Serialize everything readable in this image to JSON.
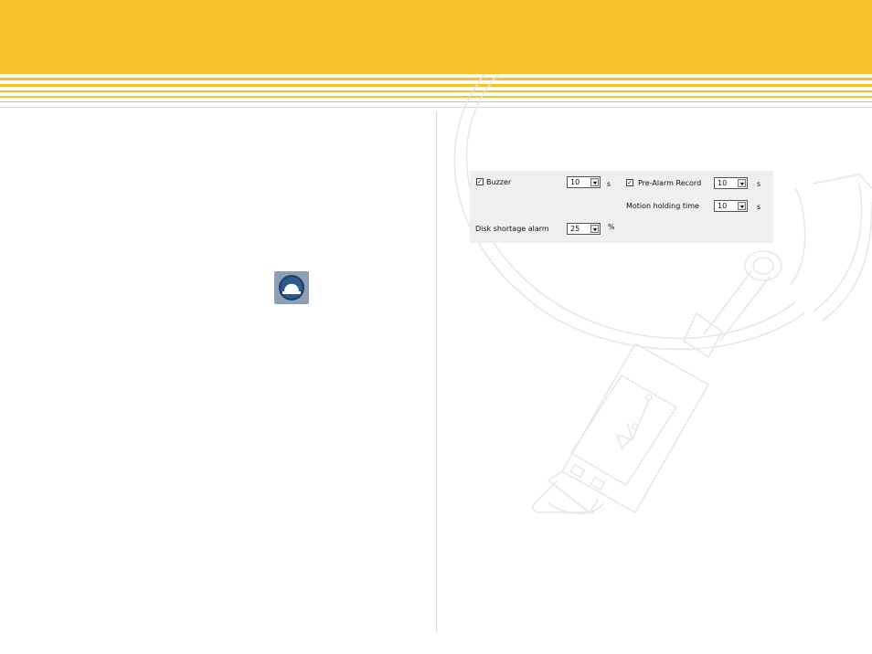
{
  "alarm_settings": {
    "buzzer": {
      "label": "Buzzer",
      "checked": true,
      "value": "10",
      "unit": "s"
    },
    "pre_alarm_record": {
      "label": "Pre-Alarm Record",
      "checked": true,
      "value": "10",
      "unit": "s"
    },
    "motion_holding_time": {
      "label": "Motion holding time",
      "value": "10",
      "unit": "s"
    },
    "disk_shortage_alarm": {
      "label": "Disk shortage alarm",
      "value": "25",
      "unit": "%"
    }
  },
  "icons": {
    "alarm": "alarm-light-icon",
    "watermark": "usb-cable-icon",
    "check": "✓"
  },
  "colors": {
    "header": "#f7c12c",
    "panel": "#efefef",
    "divider": "#d9d9d9",
    "watermark": "#e6e6e6"
  }
}
